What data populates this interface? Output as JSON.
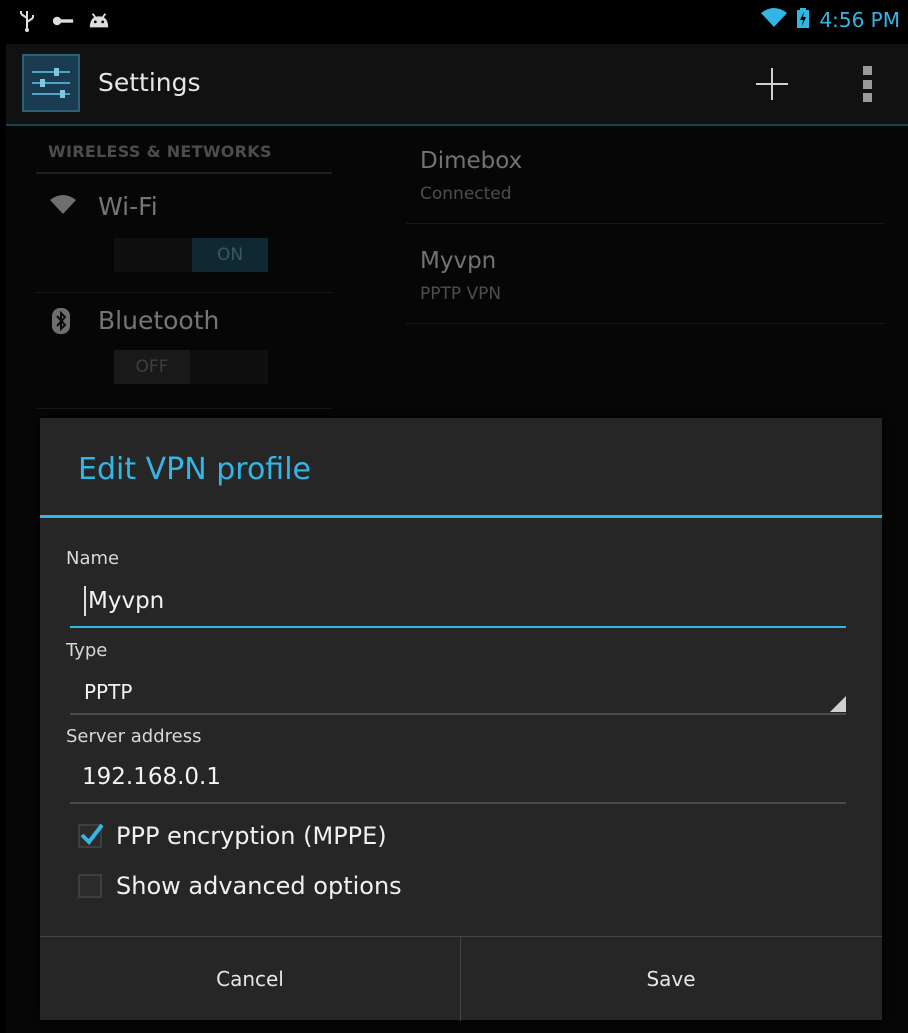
{
  "status_bar": {
    "left_icons": [
      "usb-icon",
      "key-icon",
      "android-icon"
    ],
    "right_icons": [
      "wifi-icon",
      "battery-charging-icon"
    ],
    "time": "4:56 PM",
    "accent": "#33b5e5"
  },
  "action_bar": {
    "title": "Settings",
    "icons": [
      "settings-app-icon",
      "add-icon",
      "overflow-menu-icon"
    ]
  },
  "left_pane": {
    "section_header": "WIRELESS & NETWORKS",
    "items": [
      {
        "label": "Wi-Fi",
        "icon": "wifi-icon",
        "toggle": "ON"
      },
      {
        "label": "Bluetooth",
        "icon": "bluetooth-icon",
        "toggle": "OFF"
      }
    ]
  },
  "vpn_list": [
    {
      "name": "Dimebox",
      "status": "Connected"
    },
    {
      "name": "Myvpn",
      "status": "PPTP VPN"
    }
  ],
  "dialog": {
    "title": "Edit VPN profile",
    "name_label": "Name",
    "name_value": "Myvpn",
    "type_label": "Type",
    "type_value": "PPTP",
    "server_label": "Server address",
    "server_value": "192.168.0.1",
    "ppp_encryption_label": "PPP encryption (MPPE)",
    "ppp_encryption_checked": true,
    "advanced_label": "Show advanced options",
    "advanced_checked": false,
    "cancel_label": "Cancel",
    "save_label": "Save"
  }
}
